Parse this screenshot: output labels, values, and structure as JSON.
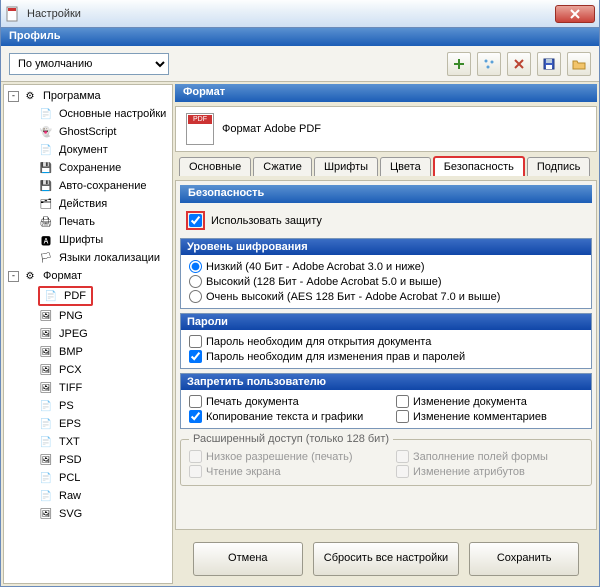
{
  "window": {
    "title": "Настройки"
  },
  "profile": {
    "label": "Профиль",
    "selected": "По умолчанию"
  },
  "toolbar_icons": [
    "add",
    "reset",
    "delete",
    "save",
    "folder"
  ],
  "tree": {
    "root": "Программа",
    "items": [
      "Основные настройки",
      "GhostScript",
      "Документ",
      "Сохранение",
      "Авто-сохранение",
      "Действия",
      "Печать",
      "Шрифты",
      "Языки локализации"
    ],
    "format_root": "Формат",
    "formats": [
      "PDF",
      "PNG",
      "JPEG",
      "BMP",
      "PCX",
      "TIFF",
      "PS",
      "EPS",
      "TXT",
      "PSD",
      "PCL",
      "Raw",
      "SVG"
    ],
    "selected_format": "PDF"
  },
  "format_panel": {
    "header": "Формат",
    "name": "Формат Adobe PDF"
  },
  "tabs": {
    "items": [
      "Основные",
      "Сжатие",
      "Шрифты",
      "Цвета",
      "Безопасность",
      "Подпись"
    ],
    "active": "Безопасность"
  },
  "security": {
    "header": "Безопасность",
    "use_protection": "Использовать защиту",
    "encryption": {
      "header": "Уровень шифрования",
      "low": "Низкий (40 Бит - Adobe Acrobat 3.0 и ниже)",
      "high": "Высокий (128 Бит - Adobe Acrobat 5.0 и выше)",
      "very_high": "Очень высокий (AES 128 Бит - Adobe Acrobat 7.0 и выше)"
    },
    "passwords": {
      "header": "Пароли",
      "open": "Пароль необходим для открытия документа",
      "perm": "Пароль необходим для изменения прав и паролей"
    },
    "deny": {
      "header": "Запретить пользователю",
      "print": "Печать документа",
      "modify": "Изменение документа",
      "copy": "Копирование текста и графики",
      "comments": "Изменение комментариев"
    },
    "advanced": {
      "header": "Расширенный доступ (только 128 бит)",
      "lowres": "Низкое разрешение (печать)",
      "form": "Заполнение полей формы",
      "screen": "Чтение экрана",
      "attrs": "Изменение атрибутов"
    }
  },
  "buttons": {
    "cancel": "Отмена",
    "reset": "Сбросить все настройки",
    "save": "Сохранить"
  }
}
